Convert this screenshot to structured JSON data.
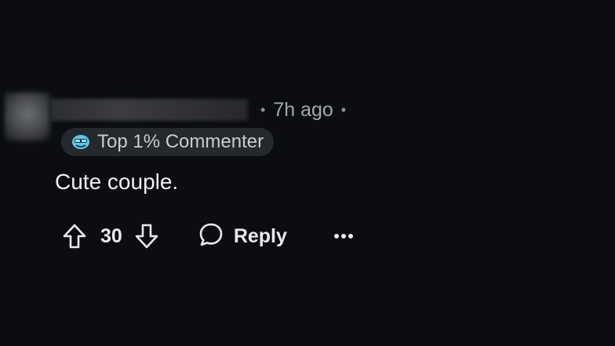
{
  "comment": {
    "meta": {
      "separator_before": "•",
      "time": "7h ago",
      "separator_after": "•"
    },
    "badge": {
      "icon": "commenter-badge-icon",
      "label": "Top 1% Commenter"
    },
    "body": "Cute couple.",
    "actions": {
      "upvote_icon": "arrow-up-icon",
      "score": "30",
      "downvote_icon": "arrow-down-icon",
      "reply_icon": "speech-bubble-icon",
      "reply_label": "Reply",
      "more_icon": "ellipsis-icon"
    }
  },
  "colors": {
    "background": "#0b0d10",
    "text": "#eef0f2",
    "muted": "#a4a8ad",
    "badge_bg": "#24292e"
  }
}
